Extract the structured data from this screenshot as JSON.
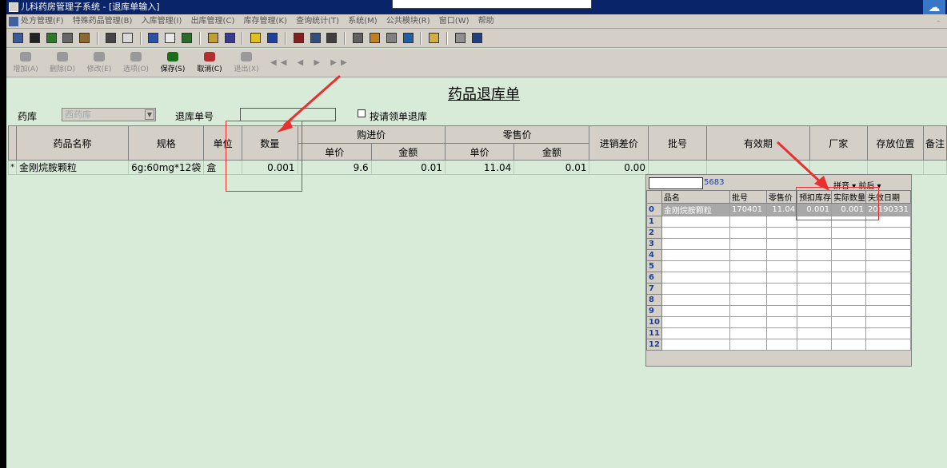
{
  "window": {
    "title": "儿科药房管理子系统 - [退库单输入]"
  },
  "menu": {
    "items": [
      "处方管理(F)",
      "特殊药品管理(B)",
      "入库管理(I)",
      "出库管理(C)",
      "库存管理(K)",
      "查询统计(T)",
      "系统(M)",
      "公共模块(R)",
      "窗口(W)",
      "帮助"
    ],
    "minimize": "–"
  },
  "toolbar": {
    "add": "增加(A)",
    "delete": "删除(D)",
    "edit": "修改(E)",
    "options": "选项(O)",
    "save": "保存(S)",
    "cancel": "取消(C)",
    "exit": "退出(X)",
    "nav": "◀◀ ◀ ▶ ▶▶"
  },
  "doc": {
    "title": "药品退库单"
  },
  "form": {
    "pharmacy_label": "药库",
    "pharmacy_value": "西药库",
    "return_no_label": "退库单号",
    "return_no_value": "",
    "by_request_label": "按请领单退库"
  },
  "grid": {
    "headers": {
      "name": "药品名称",
      "spec": "规格",
      "unit": "单位",
      "qty": "数量",
      "purchase": "购进价",
      "retail": "零售价",
      "unit_price": "单价",
      "amount": "金额",
      "diff": "进销差价",
      "batch": "批号",
      "expiry": "有效期",
      "maker": "厂家",
      "location": "存放位置",
      "remark": "备注"
    },
    "row": {
      "marker": "*",
      "name": "金刚烷胺颗粒",
      "spec": "6g:60mg*12袋",
      "unit": "盒",
      "qty": "0.001",
      "purchase_price": "9.6",
      "purchase_amount": "0.01",
      "retail_price": "11.04",
      "retail_amount": "0.01",
      "diff": "0.00",
      "batch": "",
      "expiry": "",
      "maker": "",
      "location": "",
      "remark": ""
    }
  },
  "popup": {
    "code": "5683",
    "options": "拼音 ▾ 前后 ▾",
    "headers": [
      "品名",
      "批号",
      "零售价",
      "预扣库存",
      "实际数量",
      "失效日期"
    ],
    "rows": [
      {
        "n": "0",
        "name": "金刚烷胺颗粒",
        "batch": "170401",
        "retail": "11.04",
        "withheld": "0.001",
        "actual": "0.001",
        "expire": "20190331"
      }
    ],
    "row_numbers": [
      "1",
      "2",
      "3",
      "4",
      "5",
      "6",
      "7",
      "8",
      "9",
      "10",
      "11",
      "12"
    ]
  },
  "colors": {
    "background": "#d8ead8",
    "titlebar": "#0a246a",
    "annotation": "#e83030"
  }
}
